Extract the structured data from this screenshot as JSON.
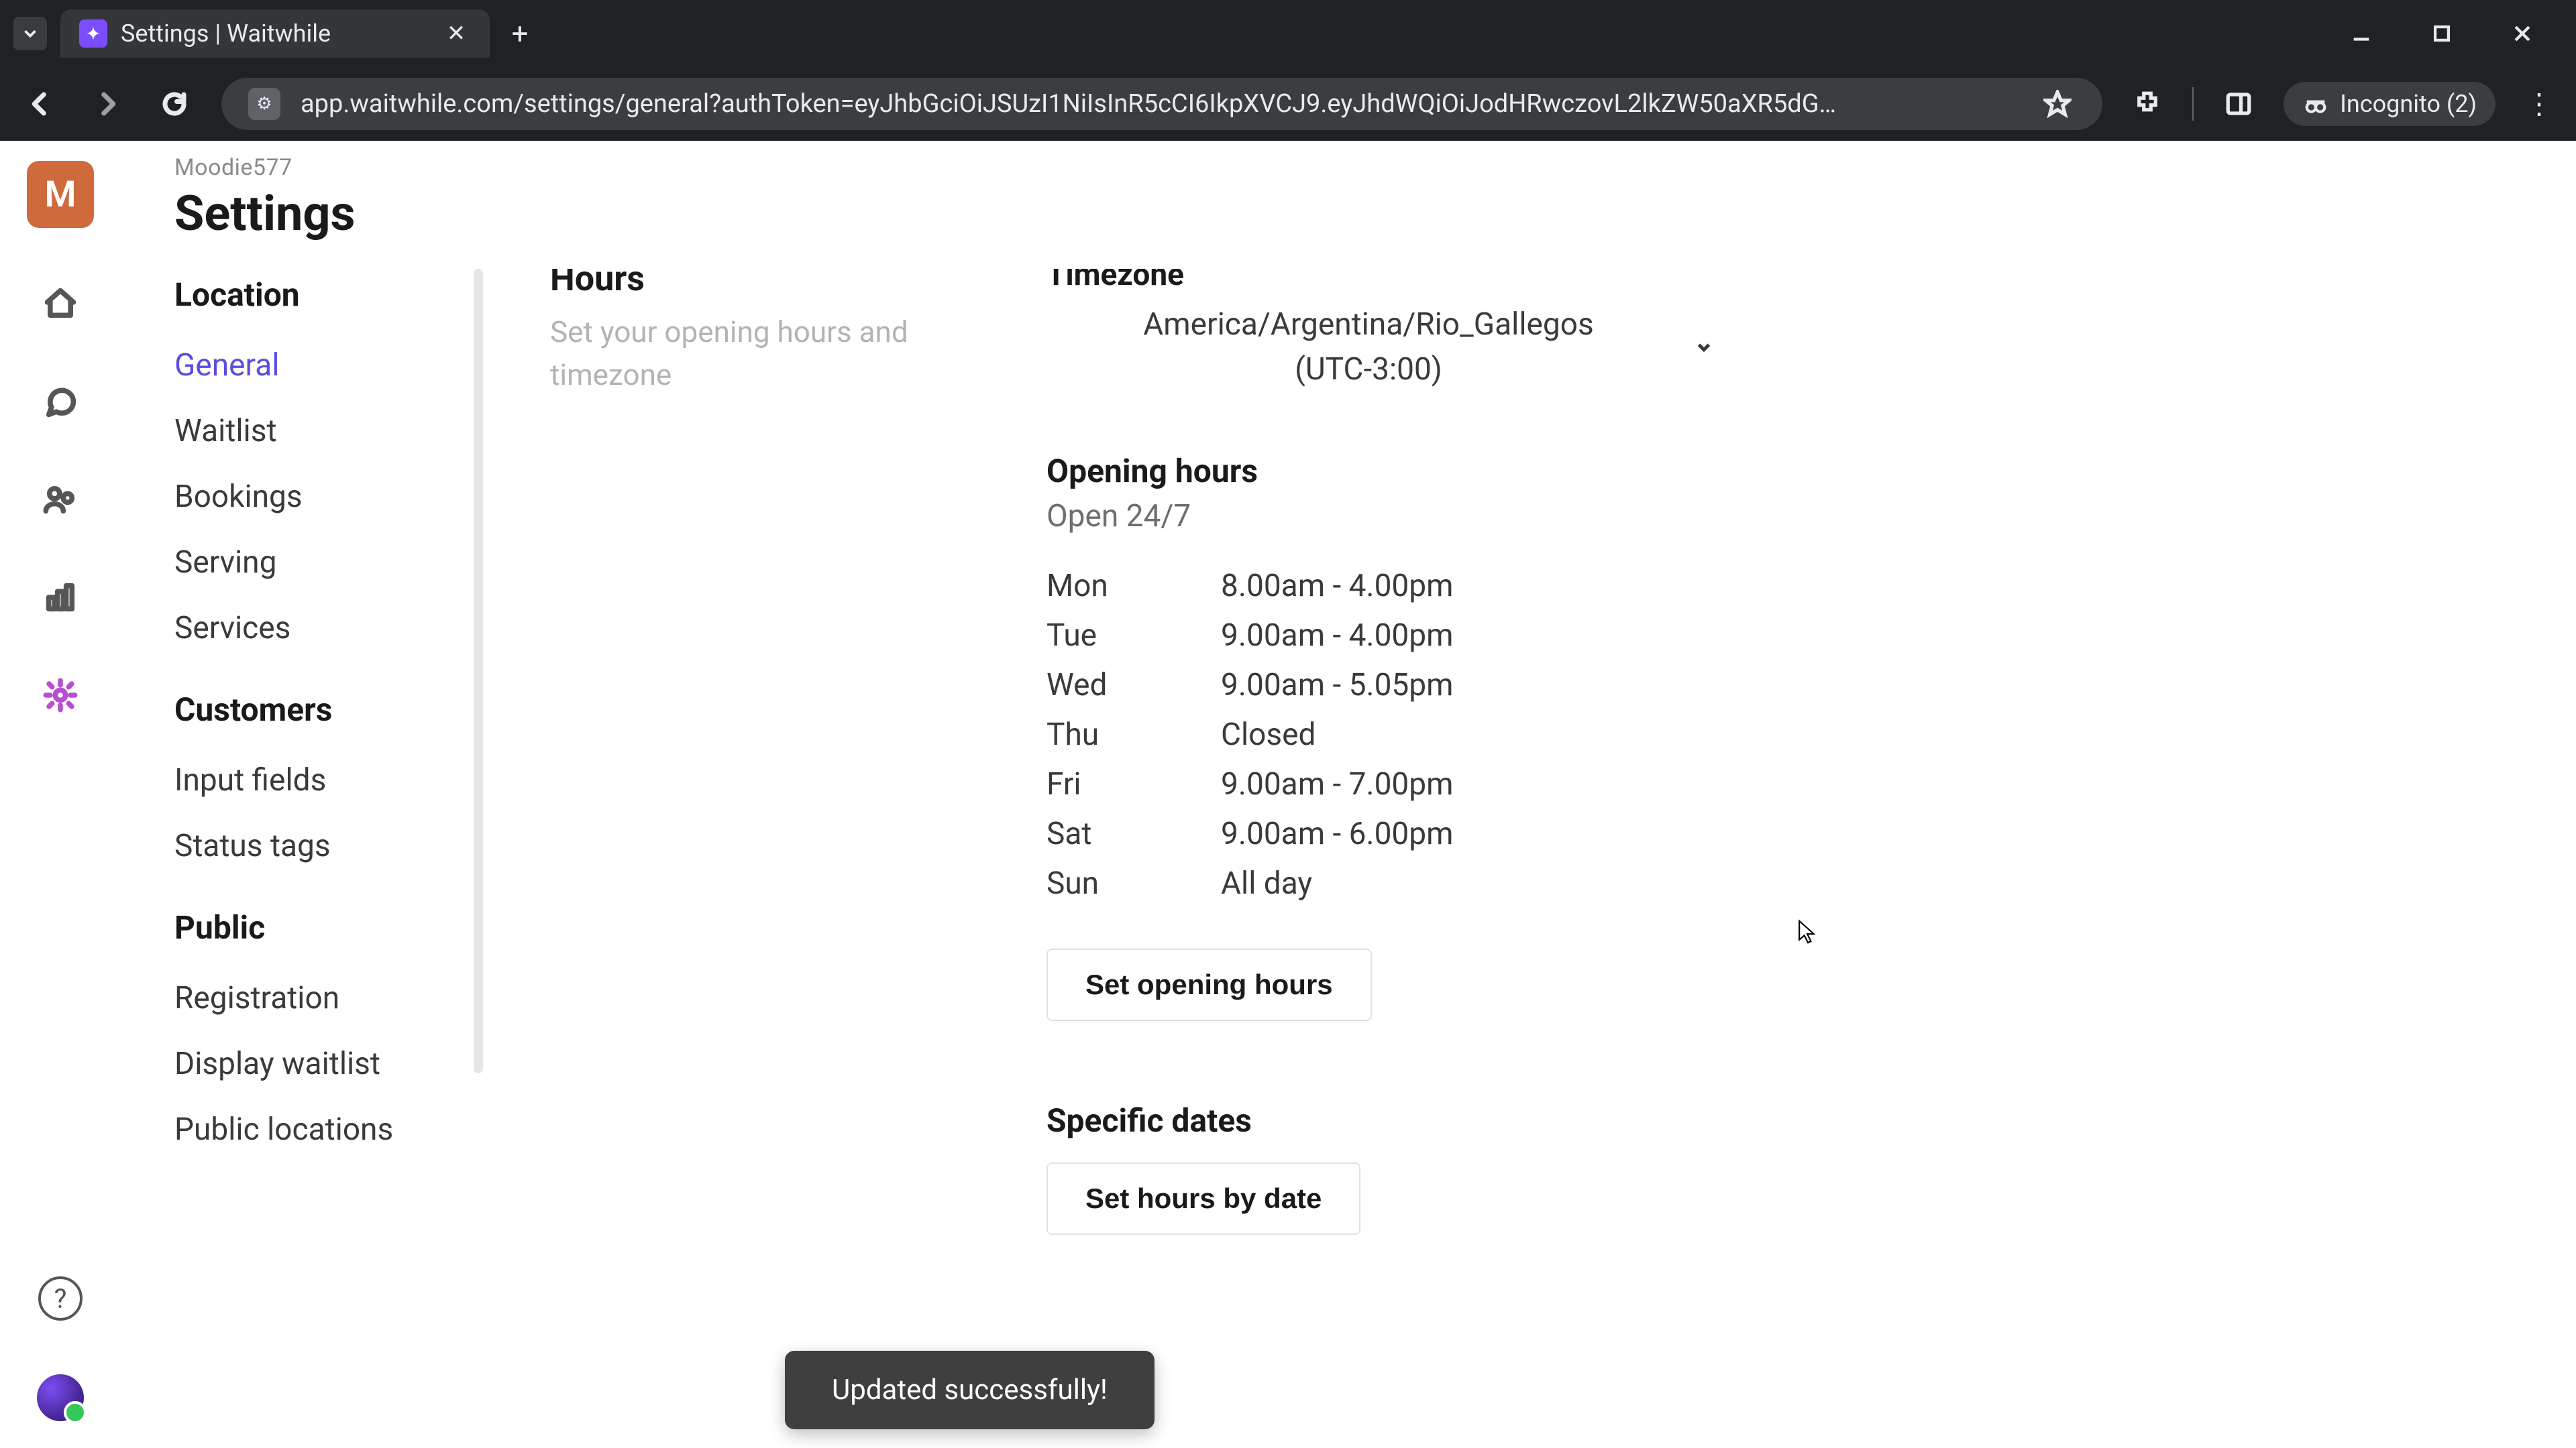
{
  "browser": {
    "tab_title": "Settings | Waitwhile",
    "url": "app.waitwhile.com/settings/general?authToken=eyJhbGciOiJSUzI1NiIsInR5cCI6IkpXVCJ9.eyJhdWQiOiJodHRwczovL2lkZW50aXR5dG…",
    "incognito_label": "Incognito (2)"
  },
  "header": {
    "org_initial": "M",
    "org_name": "Moodie577",
    "page_title": "Settings"
  },
  "sidebar": {
    "groups": [
      {
        "label": "Location",
        "items": [
          "General",
          "Waitlist",
          "Bookings",
          "Serving",
          "Services"
        ],
        "active": "General"
      },
      {
        "label": "Customers",
        "items": [
          "Input fields",
          "Status tags"
        ]
      },
      {
        "label": "Public",
        "items": [
          "Registration",
          "Display waitlist",
          "Public locations"
        ]
      }
    ]
  },
  "hours_section": {
    "title": "Hours",
    "description": "Set your opening hours and timezone",
    "timezone_label": "Timezone",
    "timezone_value_line1": "America/Argentina/Rio_Gallegos",
    "timezone_value_line2": "(UTC-3:00)",
    "opening_hours_label": "Opening hours",
    "opening_hours_sub": "Open 24/7",
    "days": [
      {
        "day": "Mon",
        "hours": "8.00am - 4.00pm"
      },
      {
        "day": "Tue",
        "hours": "9.00am - 4.00pm"
      },
      {
        "day": "Wed",
        "hours": "9.00am - 5.05pm"
      },
      {
        "day": "Thu",
        "hours": "Closed"
      },
      {
        "day": "Fri",
        "hours": "9.00am - 7.00pm"
      },
      {
        "day": "Sat",
        "hours": "9.00am - 6.00pm"
      },
      {
        "day": "Sun",
        "hours": "All day"
      }
    ],
    "set_opening_hours_btn": "Set opening hours",
    "specific_dates_label": "Specific dates",
    "set_hours_by_date_btn": "Set hours by date"
  },
  "toast": {
    "message": "Updated successfully!"
  }
}
